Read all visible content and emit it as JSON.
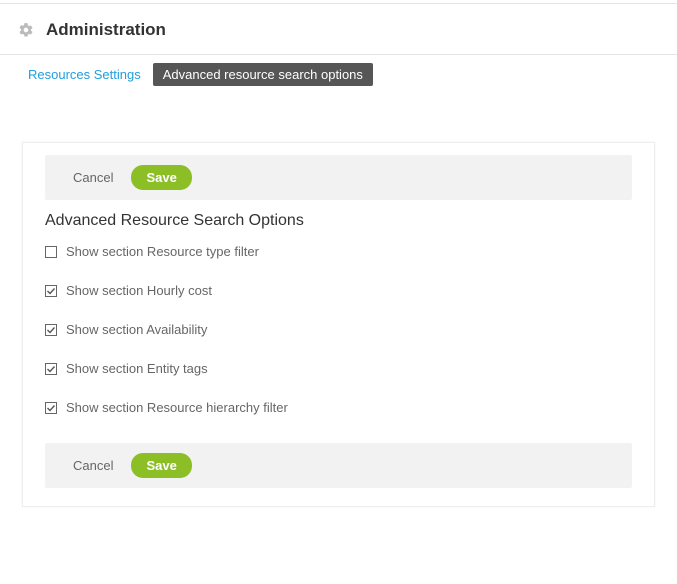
{
  "header": {
    "title": "Administration"
  },
  "tabs": {
    "inactive": "Resources Settings",
    "active": "Advanced resource search options"
  },
  "buttons": {
    "cancel": "Cancel",
    "save": "Save"
  },
  "section": {
    "title": "Advanced Resource Search Options"
  },
  "options": [
    {
      "label": "Show section Resource type filter",
      "checked": false
    },
    {
      "label": "Show section Hourly cost",
      "checked": true
    },
    {
      "label": "Show section Availability",
      "checked": true
    },
    {
      "label": "Show section Entity tags",
      "checked": true
    },
    {
      "label": "Show section Resource hierarchy filter",
      "checked": true
    }
  ]
}
